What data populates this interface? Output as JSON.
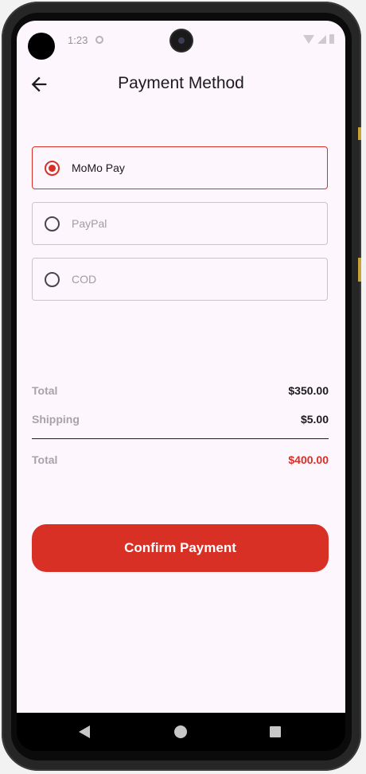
{
  "status_bar": {
    "time": "1:23"
  },
  "app_bar": {
    "title": "Payment Method"
  },
  "payment_options": [
    {
      "label": "MoMo Pay",
      "selected": true
    },
    {
      "label": "PayPal",
      "selected": false
    },
    {
      "label": "COD",
      "selected": false
    }
  ],
  "summary": {
    "subtotal_label": "Total",
    "subtotal_value": "$350.00",
    "shipping_label": "Shipping",
    "shipping_value": "$5.00",
    "total_label": "Total",
    "total_value": "$400.00"
  },
  "confirm_button_label": "Confirm Payment",
  "colors": {
    "accent": "#d93025",
    "background": "#fdf6fd",
    "muted_text": "#a8a3aa"
  },
  "icons": {
    "back": "arrow-left-icon",
    "radio_selected": "radio-checked-icon",
    "radio_unselected": "radio-unchecked-icon",
    "nav_back": "triangle-back-icon",
    "nav_home": "circle-home-icon",
    "nav_recents": "square-recents-icon"
  }
}
